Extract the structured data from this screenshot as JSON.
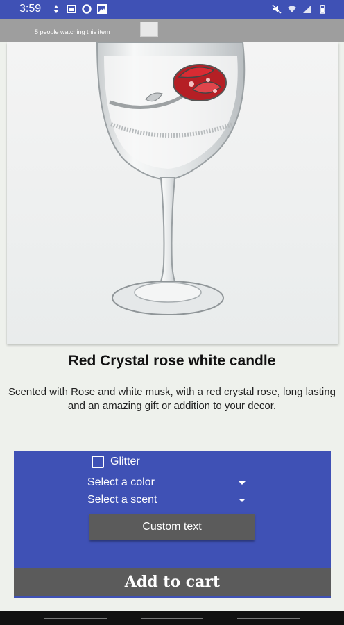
{
  "status_bar": {
    "time": "3:59",
    "left_icons": [
      "app-notification-icon",
      "image-icon",
      "circle-app-icon",
      "photo-icon"
    ],
    "right_icons": [
      "mute-icon",
      "wifi-icon",
      "signal-icon",
      "battery-icon"
    ]
  },
  "banner": {
    "text": "5 people watching this item"
  },
  "product": {
    "title": "Red Crystal rose white candle",
    "description": "Scented with Rose and white musk, with a red crystal rose, long lasting and an amazing gift or addition to your decor."
  },
  "options": {
    "glitter_label": "Glitter",
    "glitter_checked": false,
    "color_select": "Select a color",
    "scent_select": "Select a scent",
    "custom_text_label": "Custom text"
  },
  "cart": {
    "add_label": "Add to cart"
  },
  "colors": {
    "accent": "#3f51b5",
    "button": "#5b5b5b",
    "background": "#eef1ec"
  }
}
